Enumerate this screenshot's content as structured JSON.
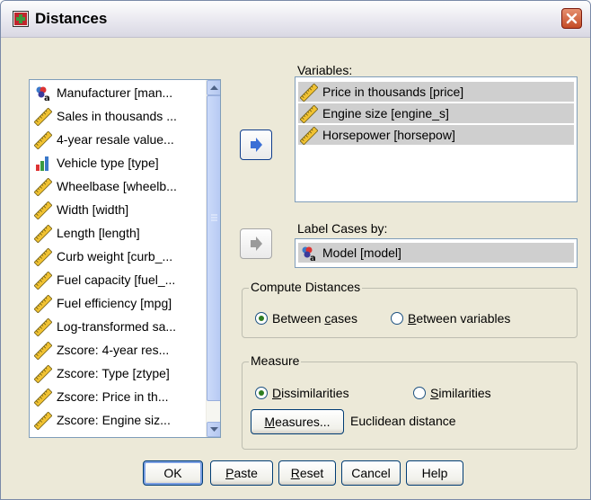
{
  "window": {
    "title": "Distances",
    "app_icon": "spss-dialog-icon",
    "close_icon": "close-icon"
  },
  "source_list": {
    "items": [
      {
        "label": "Manufacturer [man...",
        "icon": "nominal-string-icon"
      },
      {
        "label": "Sales in thousands ...",
        "icon": "scale-ruler-icon"
      },
      {
        "label": "4-year resale value...",
        "icon": "scale-ruler-icon"
      },
      {
        "label": "Vehicle type [type]",
        "icon": "ordinal-bar-icon"
      },
      {
        "label": "Wheelbase [wheelb...",
        "icon": "scale-ruler-icon"
      },
      {
        "label": "Width [width]",
        "icon": "scale-ruler-icon"
      },
      {
        "label": "Length [length]",
        "icon": "scale-ruler-icon"
      },
      {
        "label": "Curb weight [curb_...",
        "icon": "scale-ruler-icon"
      },
      {
        "label": "Fuel capacity [fuel_...",
        "icon": "scale-ruler-icon"
      },
      {
        "label": "Fuel efficiency [mpg]",
        "icon": "scale-ruler-icon"
      },
      {
        "label": "Log-transformed sa...",
        "icon": "scale-ruler-icon"
      },
      {
        "label": "Zscore:  4-year res...",
        "icon": "scale-ruler-icon"
      },
      {
        "label": "Zscore:  Type [ztype]",
        "icon": "scale-ruler-icon"
      },
      {
        "label": "Zscore:  Price in th...",
        "icon": "scale-ruler-icon"
      },
      {
        "label": "Zscore:  Engine siz...",
        "icon": "scale-ruler-icon"
      }
    ]
  },
  "variables": {
    "label": "Variables:",
    "items": [
      {
        "label": "Price in thousands [price]",
        "icon": "scale-ruler-icon"
      },
      {
        "label": "Engine size [engine_s]",
        "icon": "scale-ruler-icon"
      },
      {
        "label": "Horsepower [horsepow]",
        "icon": "scale-ruler-icon"
      }
    ]
  },
  "label_cases": {
    "label": "Label Cases by:",
    "item": {
      "label": "Model [model]",
      "icon": "nominal-string-icon"
    }
  },
  "compute": {
    "title": "Compute Distances",
    "between_cases": "Between cases",
    "between_variables": "Between variables",
    "selected": "between_cases"
  },
  "measure": {
    "title": "Measure",
    "dissimilarities": "Dissimilarities",
    "similarities": "Similarities",
    "selected": "dissimilarities",
    "measures_button": "Measures...",
    "current_measure": "Euclidean distance"
  },
  "buttons": {
    "ok": "OK",
    "paste": "Paste",
    "reset": "Reset",
    "cancel": "Cancel",
    "help": "Help"
  },
  "colors": {
    "dialog_bg": "#ece9d8",
    "selection_bg": "#cfcfcf",
    "move_arrow": "#3b6fd6"
  }
}
